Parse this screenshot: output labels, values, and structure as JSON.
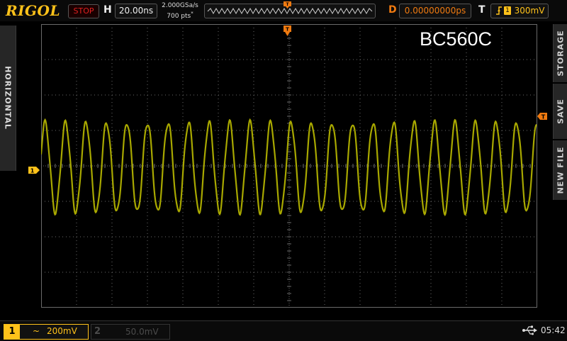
{
  "header": {
    "brand": "RIGOL",
    "run_status": "STOP",
    "horizontal_label": "H",
    "timebase": "20.00ns",
    "sample_rate": "2.000GSa/s",
    "memory_depth": "700 pts",
    "delay_label": "D",
    "delay_value": "0.00000000ps",
    "trigger_label": "T",
    "trigger_source": "1",
    "trigger_level": "300mV"
  },
  "left_tab": {
    "label": "HORIZONTAL"
  },
  "right_menu": {
    "items": [
      {
        "label": "STORAGE"
      },
      {
        "label": "SAVE"
      },
      {
        "label": "NEW FILE"
      }
    ]
  },
  "screen": {
    "waveform_label": "BC560C",
    "ch1_marker": "1",
    "trigger_position_marker": "T",
    "trigger_level_marker": "T"
  },
  "footer": {
    "ch1": {
      "number": "1",
      "coupling": "~",
      "scale": "200mV"
    },
    "ch2": {
      "number": "2",
      "scale": "50.0mV"
    },
    "time": "05:42"
  },
  "colors": {
    "ch1": "#ffc21a",
    "trace": "#a8a800",
    "trigger": "#f07a10",
    "stop": "#e02020",
    "grid": "#6a6a6a"
  },
  "icons": [
    "trigger-edge-rising-icon",
    "usb-icon",
    "trigger-position-icon",
    "ch1-offset-icon",
    "trigger-level-icon"
  ]
}
